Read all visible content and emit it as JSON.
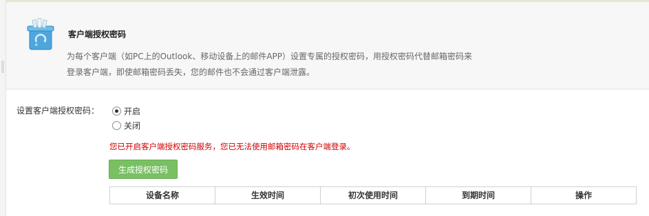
{
  "intro": {
    "icon": "recycle-bin-icon",
    "title": "客户端授权密码",
    "description": "为每个客户端（如PC上的Outlook、移动设备上的邮件APP）设置专属的授权密码，用授权密码代替邮箱密码来登录客户端，即使邮箱密码丢失，您的邮件也不会通过客户端泄露。"
  },
  "setting": {
    "label": "设置客户端授权密码：",
    "options": [
      {
        "label": "开启",
        "selected": true
      },
      {
        "label": "关闭",
        "selected": false
      }
    ],
    "notice": "您已开启客户端授权密码服务，您已无法使用邮箱密码在客户端登录。",
    "notice_color": "#d00000"
  },
  "generate_button": {
    "label": "生成授权密码",
    "color": "#79c063"
  },
  "table": {
    "headers": [
      "设备名称",
      "生效时间",
      "初次使用时间",
      "到期时间",
      "操作"
    ]
  }
}
